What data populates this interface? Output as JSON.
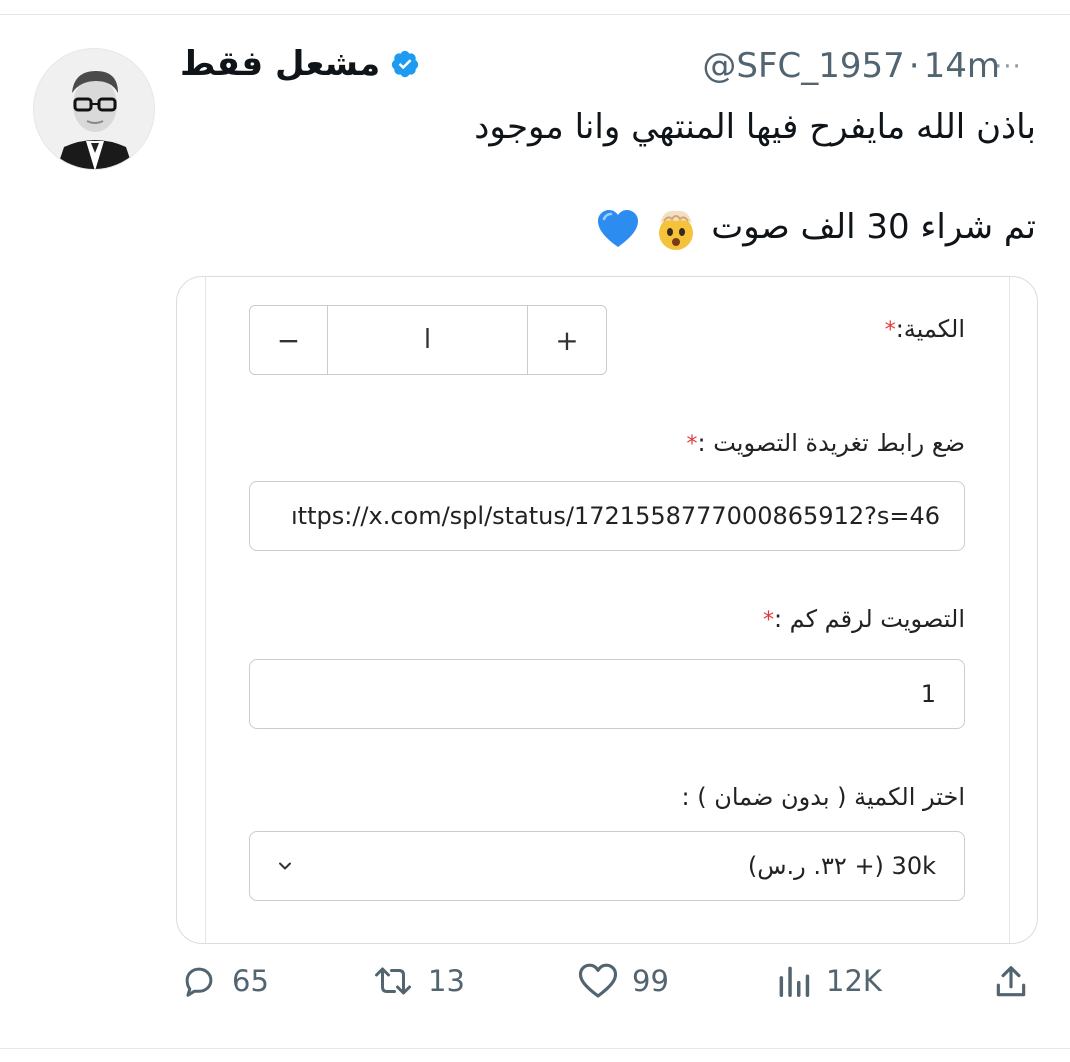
{
  "tweet": {
    "display_name": "مشعل فقط",
    "handle": "@SFC_1957",
    "separator": "·",
    "time": "14m",
    "more_label": "···",
    "text_line1": "باذن الله مايفرح فيها المنتهي وانا موجود",
    "text_line2": "تم شراء 30 الف صوت",
    "emojis": [
      "exploding-head-emoji",
      "blue-heart-emoji"
    ]
  },
  "form": {
    "quantity_label": "الكمية:",
    "quantity_value": "ا",
    "minus_label": "−",
    "plus_label": "+",
    "tweet_link_label": "ضع رابط تغريدة التصويت :",
    "tweet_link_value": "ıttps://x.com/spl/status/1721558777000865912?s=46",
    "vote_number_label": "التصويت لرقم كم :",
    "vote_number_value": "1",
    "amount_label": "اختر الكمية ( بدون ضمان ) :",
    "amount_value": "(٣٢. ر.س +) 30k",
    "required_mark": "*"
  },
  "actions": {
    "replies": "65",
    "retweets": "13",
    "likes": "99",
    "views": "12K"
  },
  "colors": {
    "verified": "#1d9bf0",
    "required": "#e03b3b",
    "muted": "#536471",
    "border": "#c9cdd2"
  }
}
